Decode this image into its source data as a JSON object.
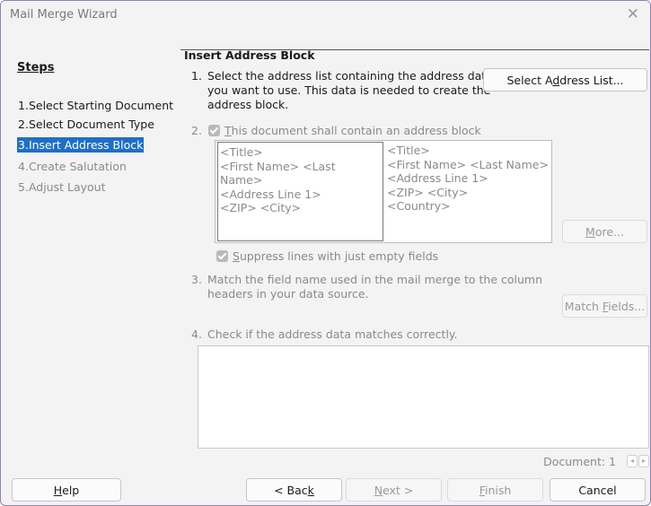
{
  "window": {
    "title": "Mail Merge Wizard",
    "close_glyph": "✕"
  },
  "steps": {
    "heading": "Steps",
    "items": [
      {
        "num": "1.",
        "label": "Select Starting Document",
        "state": "done"
      },
      {
        "num": "2.",
        "label": "Select Document Type",
        "state": "done"
      },
      {
        "num": "3.",
        "label": "Insert Address Block",
        "state": "current"
      },
      {
        "num": "4.",
        "label": "Create Salutation",
        "state": "future"
      },
      {
        "num": "5.",
        "label": "Adjust Layout",
        "state": "future"
      }
    ]
  },
  "main": {
    "section_title": "Insert Address Block",
    "step1": {
      "num": "1.",
      "line1": "Select the address list containing the address data",
      "line2": "you want to use. This data is needed to create the",
      "line3": "address block.",
      "button_pre": "Select A",
      "button_key": "d",
      "button_post": "dress List..."
    },
    "step2": {
      "num": "2.",
      "check_key": "T",
      "check_rest": "his document shall contain an address block",
      "checked": true
    },
    "preview": {
      "block1": [
        "<Title>",
        "<First Name> <Last Name>",
        "<Address Line 1>",
        "<ZIP> <City>"
      ],
      "block2": [
        "<Title>",
        "<First Name> <Last Name>",
        "<Address Line 1>",
        "<ZIP> <City>",
        "<Country>"
      ]
    },
    "more_button": {
      "key": "M",
      "rest": "ore..."
    },
    "suppress": {
      "key": "S",
      "rest": "uppress lines with just empty fields",
      "checked": true
    },
    "step3": {
      "num": "3.",
      "line1": "Match the field name used in the mail merge to the column",
      "line2": "headers in your data source.",
      "button_pre": "Match ",
      "button_key": "F",
      "button_post": "ields..."
    },
    "step4": {
      "num": "4.",
      "text": "Check if the address data matches correctly."
    },
    "document_label": "Document: 1",
    "spin_prev": "◂",
    "spin_next": "▸"
  },
  "footer": {
    "help": {
      "key": "H",
      "rest": "elp"
    },
    "back": {
      "pre": "< Bac",
      "key": "k"
    },
    "next": {
      "key": "N",
      "rest": "ext >"
    },
    "finish": {
      "key": "F",
      "rest": "inish"
    },
    "cancel": "Cancel"
  }
}
